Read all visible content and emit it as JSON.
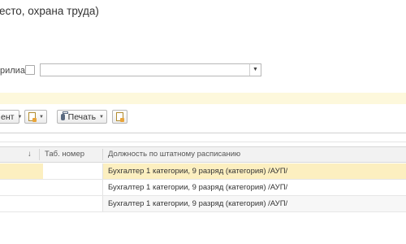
{
  "title": "есто, охрана труда)",
  "filter": {
    "label": "рилиал:"
  },
  "toolbar": {
    "first_label": "ент",
    "print_label": "Печать"
  },
  "table": {
    "columns": [
      "↓",
      "Таб. номер",
      "Должность по штатному расписанию"
    ],
    "rows": [
      {
        "tab_number": "",
        "position": "Бухгалтер 1 категории, 9 разряд (категория) /АУП/",
        "selected": true
      },
      {
        "tab_number": "",
        "position": "Бухгалтер 1 категории, 9 разряд (категория) /АУП/",
        "selected": false
      },
      {
        "tab_number": "",
        "position": "Бухгалтер 1 категории, 9 разряд (категория) /АУП/",
        "selected": false
      }
    ]
  }
}
